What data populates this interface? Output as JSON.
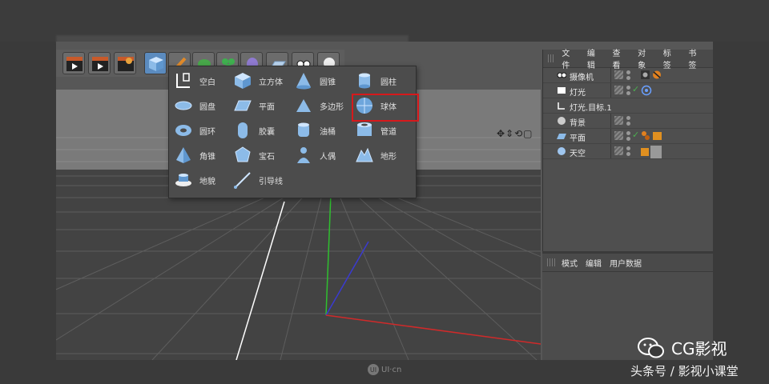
{
  "popup": {
    "items": [
      {
        "label": "空白",
        "icon": "null-object-icon"
      },
      {
        "label": "立方体",
        "icon": "cube-icon"
      },
      {
        "label": "圆锥",
        "icon": "cone-icon"
      },
      {
        "label": "圆柱",
        "icon": "cylinder-icon"
      },
      {
        "label": "圆盘",
        "icon": "disc-icon"
      },
      {
        "label": "平面",
        "icon": "plane-icon"
      },
      {
        "label": "多边形",
        "icon": "polygon-icon"
      },
      {
        "label": "球体",
        "icon": "sphere-icon"
      },
      {
        "label": "圆环",
        "icon": "torus-icon"
      },
      {
        "label": "胶囊",
        "icon": "capsule-icon"
      },
      {
        "label": "油桶",
        "icon": "oil-tank-icon"
      },
      {
        "label": "管道",
        "icon": "tube-icon"
      },
      {
        "label": "角锥",
        "icon": "pyramid-icon"
      },
      {
        "label": "宝石",
        "icon": "platonic-icon"
      },
      {
        "label": "人偶",
        "icon": "figure-icon"
      },
      {
        "label": "地形",
        "icon": "landscape-icon"
      },
      {
        "label": "地貌",
        "icon": "relief-icon"
      },
      {
        "label": "引导线",
        "icon": "guide-icon"
      }
    ],
    "highlighted": "圆柱",
    "highlight_color": "#d7191c"
  },
  "object_manager": {
    "menu": [
      "文件",
      "编辑",
      "查看",
      "对象",
      "标签",
      "书签"
    ],
    "rows": [
      {
        "name": "摄像机",
        "icon": "camera-icon"
      },
      {
        "name": "灯光",
        "icon": "light-icon"
      },
      {
        "name": "灯光.目标.1",
        "icon": "null-object-icon"
      },
      {
        "name": "背景",
        "icon": "background-icon"
      },
      {
        "name": "平面",
        "icon": "plane-icon"
      },
      {
        "name": "天空",
        "icon": "sky-icon"
      }
    ]
  },
  "attributes": {
    "menu": [
      "模式",
      "编辑",
      "用户数据"
    ]
  },
  "watermark": {
    "brand": "CG影视",
    "subtitle": "头条号 / 影视小课堂",
    "site": "UI·cn"
  }
}
